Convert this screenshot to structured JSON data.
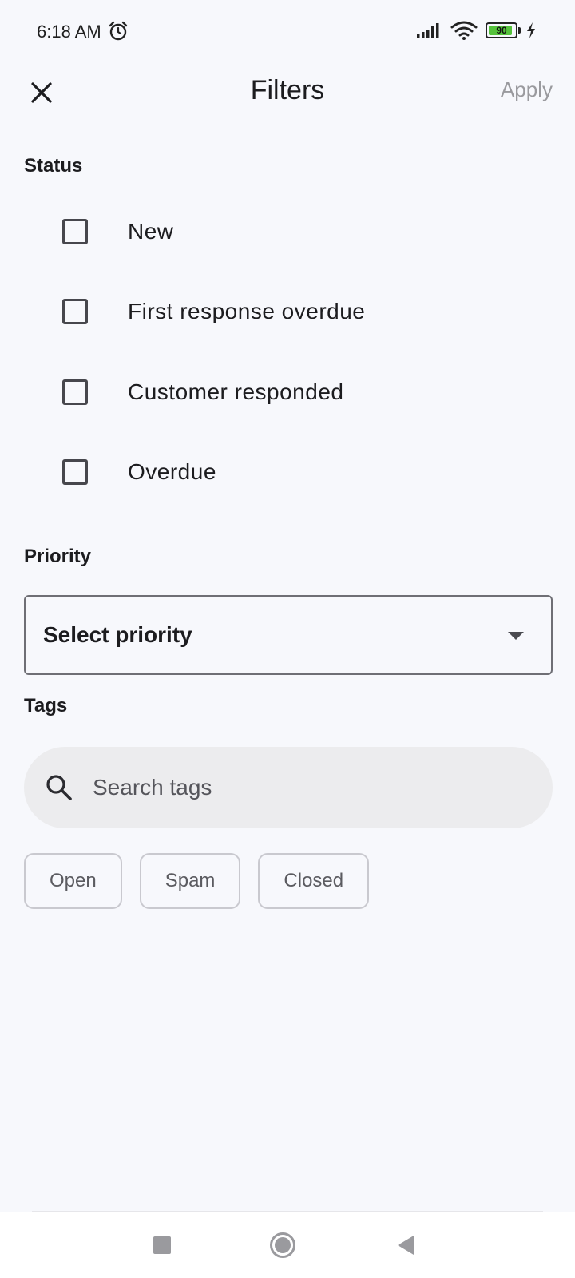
{
  "status_bar": {
    "time": "6:18 AM",
    "battery_level": "90",
    "battery_percent": 90,
    "icons": [
      "alarm-icon",
      "signal-icon",
      "wifi-icon",
      "battery-icon",
      "charging-icon"
    ]
  },
  "app_bar": {
    "title": "Filters",
    "apply_label": "Apply",
    "close_icon": "close-icon"
  },
  "status_section": {
    "label": "Status",
    "options": [
      {
        "label": "New",
        "checked": false
      },
      {
        "label": "First response overdue",
        "checked": false
      },
      {
        "label": "Customer responded",
        "checked": false
      },
      {
        "label": "Overdue",
        "checked": false
      }
    ]
  },
  "priority_section": {
    "label": "Priority",
    "selected_value": "Select priority"
  },
  "tags_section": {
    "label": "Tags",
    "search_placeholder": "Search tags",
    "chips": [
      "Open",
      "Spam",
      "Closed"
    ]
  },
  "nav_bar": {
    "icons": [
      "recents-icon",
      "home-icon",
      "back-icon"
    ]
  },
  "colors": {
    "background": "#f7f8fc",
    "apply_disabled": "#9a9a9e",
    "battery_fill": "#55c23b",
    "search_background": "#ececee"
  }
}
